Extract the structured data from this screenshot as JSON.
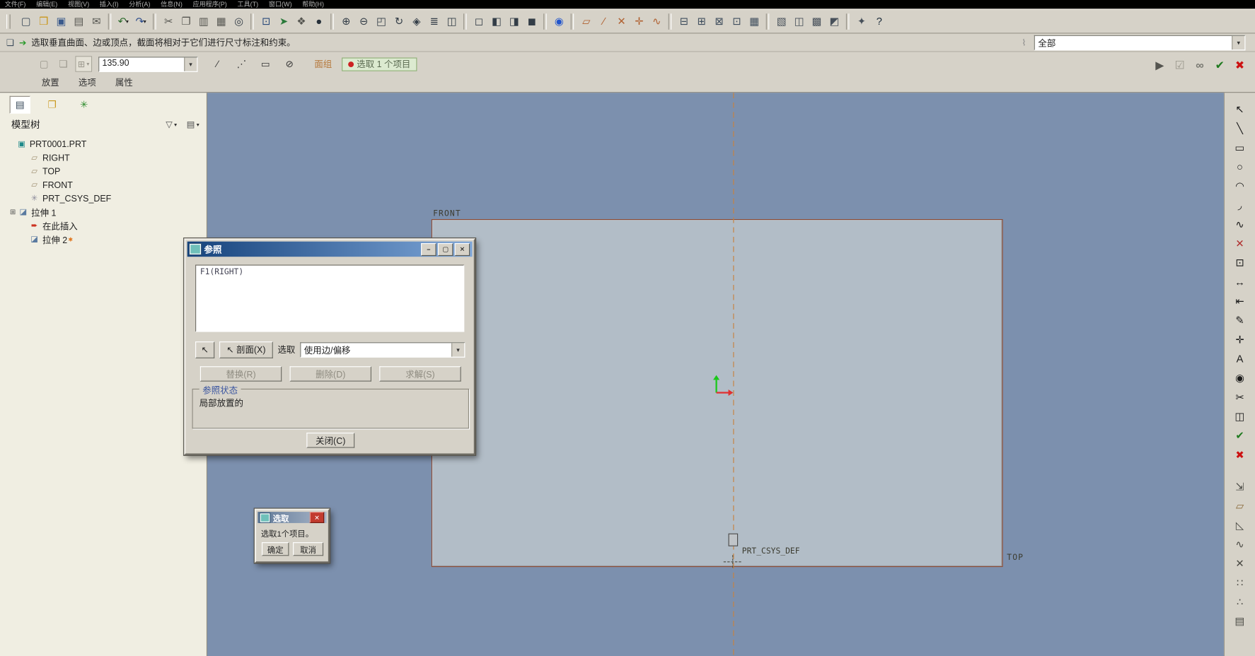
{
  "ui": {
    "caret": "▾"
  },
  "colors": {
    "toolbar_face": "#d6d2c8",
    "canvas_bg": "#7c90ae",
    "plane_fill": "#b2bdc7",
    "highlight_edge": "#8a4a34",
    "centerline": "#c8813c",
    "titlebar_active": "#16437c",
    "chip_green": "#dcead0",
    "accent_green": "#1f7a1f",
    "accent_red": "#cc1111"
  },
  "menubar": {
    "items": [
      "文件(F)",
      "编辑(E)",
      "视图(V)",
      "插入(I)",
      "分析(A)",
      "信息(N)",
      "应用程序(P)",
      "工具(T)",
      "窗口(W)",
      "帮助(H)"
    ]
  },
  "toolbar": {
    "icons": [
      {
        "name": "new-file-icon",
        "glyph": "▢",
        "color": "#3d4c5c"
      },
      {
        "name": "open-folder-icon",
        "glyph": "❒",
        "color": "#c9971c"
      },
      {
        "name": "save-icon",
        "glyph": "▣",
        "color": "#3a5a8c"
      },
      {
        "name": "print-icon",
        "glyph": "▤",
        "color": "#555550"
      },
      {
        "name": "mail-icon",
        "glyph": "✉",
        "color": "#555550"
      },
      {
        "sep": true
      },
      {
        "name": "undo-icon",
        "glyph": "↶",
        "color": "#2a6a2a",
        "caret": "▾"
      },
      {
        "name": "redo-icon",
        "glyph": "↷",
        "color": "#2a4a8a",
        "caret": "▾"
      },
      {
        "sep": true
      },
      {
        "name": "cut-icon",
        "glyph": "✂",
        "color": "#555550"
      },
      {
        "name": "copy-icon",
        "glyph": "❐",
        "color": "#555550"
      },
      {
        "name": "paste-icon",
        "glyph": "▥",
        "color": "#555550"
      },
      {
        "name": "clipboard-icon",
        "glyph": "▦",
        "color": "#555550"
      },
      {
        "name": "find-icon",
        "glyph": "◎",
        "color": "#333d47"
      },
      {
        "sep": true
      },
      {
        "name": "select-box-icon",
        "glyph": "⊡",
        "color": "#2a4a7a"
      },
      {
        "name": "smart-select-icon",
        "glyph": "➤",
        "color": "#2a7a3a"
      },
      {
        "name": "filter-list-icon",
        "glyph": "❖",
        "color": "#555550"
      },
      {
        "name": "shaded-sphere-icon",
        "glyph": "●",
        "color": "#26303a"
      },
      {
        "sep": true
      },
      {
        "name": "zoom-in-icon",
        "glyph": "⊕",
        "color": "#333d47"
      },
      {
        "name": "zoom-out-icon",
        "glyph": "⊖",
        "color": "#333d47"
      },
      {
        "name": "refit-icon",
        "glyph": "◰",
        "color": "#333d47"
      },
      {
        "name": "repaint-icon",
        "glyph": "↻",
        "color": "#333d47"
      },
      {
        "name": "reorient-icon",
        "glyph": "◈",
        "color": "#333d47"
      },
      {
        "name": "layers-icon",
        "glyph": "≣",
        "color": "#333d47"
      },
      {
        "name": "view-manager-icon",
        "glyph": "◫",
        "color": "#333d47"
      },
      {
        "sep": true
      },
      {
        "name": "wireframe-icon",
        "glyph": "◻",
        "color": "#333d47"
      },
      {
        "name": "hidden-line-icon",
        "glyph": "◧",
        "color": "#333d47"
      },
      {
        "name": "no-hidden-icon",
        "glyph": "◨",
        "color": "#333d47"
      },
      {
        "name": "shading-icon",
        "glyph": "◼",
        "color": "#333d47"
      },
      {
        "sep": true
      },
      {
        "name": "spin-center-icon",
        "glyph": "◉",
        "color": "#2255cc"
      },
      {
        "sep": true
      },
      {
        "name": "datum-plane-icon",
        "glyph": "▱",
        "color": "#b06030"
      },
      {
        "name": "datum-axis-icon",
        "glyph": "∕",
        "color": "#b06030"
      },
      {
        "name": "datum-point-icon",
        "glyph": "✕",
        "color": "#b06030"
      },
      {
        "name": "datum-csys-icon",
        "glyph": "✛",
        "color": "#b06030"
      },
      {
        "name": "datum-curve-icon",
        "glyph": "∿",
        "color": "#b06030"
      },
      {
        "sep": true
      },
      {
        "name": "plane-display-icon",
        "glyph": "⊟",
        "color": "#3d4c5c"
      },
      {
        "name": "axis-display-icon",
        "glyph": "⊞",
        "color": "#3d4c5c"
      },
      {
        "name": "point-display-icon",
        "glyph": "⊠",
        "color": "#3d4c5c"
      },
      {
        "name": "csys-display-icon",
        "glyph": "⊡",
        "color": "#3d4c5c"
      },
      {
        "name": "grid-display-icon",
        "glyph": "▦",
        "color": "#3d4c5c"
      },
      {
        "sep": true
      },
      {
        "name": "annotation-icon",
        "glyph": "▧",
        "color": "#47505a"
      },
      {
        "name": "notes-icon",
        "glyph": "◫",
        "color": "#47505a"
      },
      {
        "name": "symbols-icon",
        "glyph": "▩",
        "color": "#47505a"
      },
      {
        "name": "references-icon",
        "glyph": "◩",
        "color": "#47505a"
      },
      {
        "sep": true
      },
      {
        "name": "model-setup-icon",
        "glyph": "✦",
        "color": "#47505a"
      },
      {
        "name": "context-help-icon",
        "glyph": "?",
        "color": "#1a2a3a"
      }
    ]
  },
  "message_bar": {
    "icon_glyph": "❏",
    "arrow_glyph": "➔",
    "text": "选取垂直曲面、边或顶点，截面将相对于它们进行尺寸标注和约束。",
    "analysis_glyph": "⌇",
    "filter_value": "全部"
  },
  "dashboard": {
    "left_buttons": [
      {
        "name": "sketch-plane-icon",
        "glyph": "▢",
        "color": "#9a978c"
      },
      {
        "name": "sketch-view-icon",
        "glyph": "❏",
        "color": "#9a978c"
      }
    ],
    "grid_glyph": "⊞",
    "depth_value": "135.90",
    "mid_icons": [
      {
        "name": "flip-direction-icon",
        "glyph": "∕",
        "color": "#333"
      },
      {
        "name": "thicken-icon",
        "glyph": "⋰",
        "color": "#333"
      },
      {
        "name": "symmetric-icon",
        "glyph": "▭",
        "color": "#333"
      },
      {
        "name": "remove-material-icon",
        "glyph": "⊘",
        "color": "#333"
      }
    ],
    "surface_label": "面组",
    "status_chip": "选取 1 个项目",
    "tabs": [
      "放置",
      "选项",
      "属性"
    ],
    "right_controls": [
      {
        "name": "play-forward-icon",
        "glyph": "▶",
        "color": "#555550"
      },
      {
        "name": "pause-check-icon",
        "glyph": "☑",
        "color": "#9a978c"
      },
      {
        "name": "verify-preview-icon",
        "glyph": "∞",
        "color": "#777770"
      },
      {
        "name": "accept-feature-icon",
        "glyph": "✔",
        "color": "#1f7a1f"
      },
      {
        "name": "cancel-feature-icon",
        "glyph": "✖",
        "color": "#cc1111"
      }
    ]
  },
  "model_tree": {
    "tabs": [
      {
        "name": "model-tree-tab",
        "glyph": "▤",
        "color": "#334455",
        "selected": true
      },
      {
        "name": "folder-browser-tab",
        "glyph": "❒",
        "color": "#c9971c"
      },
      {
        "name": "favorites-tab",
        "glyph": "✳",
        "color": "#2a8a2a"
      }
    ],
    "title": "模型树",
    "filter_button_glyph": "▽",
    "columns_button_glyph": "▤",
    "items": [
      {
        "name": "tree-item-part",
        "label": "PRT0001.PRT",
        "icon": "▣",
        "icon_color": "#1f8a8a",
        "indent": 8,
        "exp": ""
      },
      {
        "name": "tree-item-right",
        "label": "RIGHT",
        "icon": "▱",
        "icon_color": "#9a8a6a",
        "indent": 24,
        "exp": ""
      },
      {
        "name": "tree-item-top",
        "label": "TOP",
        "icon": "▱",
        "icon_color": "#9a8a6a",
        "indent": 24,
        "exp": ""
      },
      {
        "name": "tree-item-front",
        "label": "FRONT",
        "icon": "▱",
        "icon_color": "#9a8a6a",
        "indent": 24,
        "exp": ""
      },
      {
        "name": "tree-item-csys",
        "label": "PRT_CSYS_DEF",
        "icon": "✳",
        "icon_color": "#8a8a9a",
        "indent": 24,
        "exp": ""
      },
      {
        "name": "tree-item-extrude1",
        "label": "拉伸 1",
        "icon": "◪",
        "icon_color": "#5a7aa0",
        "indent": 10,
        "exp": "⊞"
      },
      {
        "name": "tree-item-insert-here",
        "label": "在此插入",
        "icon": "➨",
        "icon_color": "#cc3322",
        "indent": 24,
        "exp": ""
      },
      {
        "name": "tree-item-extrude2",
        "label": "拉伸 2",
        "icon": "◪",
        "icon_color": "#5a7aa0",
        "indent": 24,
        "exp": "",
        "badge": "✱"
      }
    ]
  },
  "canvas": {
    "front_label": "FRONT",
    "top_label": "TOP",
    "csys_label": "PRT_CSYS_DEF"
  },
  "right_toolbar": {
    "icons": [
      {
        "name": "select-arrow-icon",
        "glyph": "↖",
        "color": "#1a1a1a"
      },
      {
        "name": "line-tool-icon",
        "glyph": "╲",
        "color": "#1a1a1a"
      },
      {
        "name": "rectangle-tool-icon",
        "glyph": "▭",
        "color": "#1a1a1a"
      },
      {
        "name": "circle-tool-icon",
        "glyph": "○",
        "color": "#1a1a1a"
      },
      {
        "name": "arc-tool-icon",
        "glyph": "◠",
        "color": "#1a1a1a"
      },
      {
        "name": "fillet-tool-icon",
        "glyph": "◞",
        "color": "#1a1a1a"
      },
      {
        "name": "spline-tool-icon",
        "glyph": "∿",
        "color": "#1a1a1a"
      },
      {
        "name": "point-tool-icon",
        "glyph": "✕",
        "color": "#b03030"
      },
      {
        "name": "use-edge-icon",
        "glyph": "⊡",
        "color": "#1a1a1a"
      },
      {
        "name": "dimension-tool-icon",
        "glyph": "↔",
        "color": "#1a1a1a"
      },
      {
        "name": "baseline-dim-icon",
        "glyph": "⇤",
        "color": "#1a1a1a"
      },
      {
        "name": "modify-dim-icon",
        "glyph": "✎",
        "color": "#1a1a1a"
      },
      {
        "name": "constraint-tool-icon",
        "glyph": "✛",
        "color": "#1a1a1a"
      },
      {
        "name": "text-tool-icon",
        "glyph": "A",
        "color": "#1a1a1a"
      },
      {
        "name": "palette-icon",
        "glyph": "◉",
        "color": "#1a1a1a"
      },
      {
        "name": "trim-tool-icon",
        "glyph": "✂",
        "color": "#1a1a1a"
      },
      {
        "name": "mirror-tool-icon",
        "glyph": "◫",
        "color": "#1a1a1a"
      },
      {
        "name": "sketch-done-icon",
        "glyph": "✔",
        "color": "#1f7a1f"
      },
      {
        "name": "sketch-quit-icon",
        "glyph": "✖",
        "color": "#cc1111"
      },
      {
        "sep": true
      },
      {
        "name": "offset-edge-icon",
        "glyph": "⇲",
        "color": "#4a4a44"
      },
      {
        "name": "parallelogram-icon",
        "glyph": "▱",
        "color": "#8a6a3a"
      },
      {
        "name": "chamfer-icon",
        "glyph": "◺",
        "color": "#4a4a44"
      },
      {
        "name": "curve-icon",
        "glyph": "∿",
        "color": "#4a4a44"
      },
      {
        "name": "delete-segment-icon",
        "glyph": "✕",
        "color": "#4a4a44"
      },
      {
        "name": "pattern-icon",
        "glyph": "∷",
        "color": "#4a4a44"
      },
      {
        "name": "points-grid-icon",
        "glyph": "∴",
        "color": "#4a4a44"
      },
      {
        "name": "hatch-grid-icon",
        "glyph": "▤",
        "color": "#4a4a44"
      }
    ]
  },
  "ref_dialog": {
    "title": "参照",
    "window_buttons": [
      {
        "name": "minimize-button",
        "glyph": "–"
      },
      {
        "name": "maximize-button",
        "glyph": "▢"
      },
      {
        "name": "close-button",
        "glyph": "✕"
      }
    ],
    "list_items": [
      "F1(RIGHT)"
    ],
    "arrow_button_glyph": "↖",
    "section_button": "剖面(X)",
    "select_label": "选取",
    "select_value": "使用边/偏移",
    "action_buttons": [
      {
        "name": "replace-button",
        "label": "替换(R)"
      },
      {
        "name": "delete-button",
        "label": "删除(D)"
      },
      {
        "name": "solve-button",
        "label": "求解(S)"
      }
    ],
    "group_title": "参照状态",
    "status_text": "局部放置的",
    "close_label": "关闭(C)"
  },
  "select_dialog": {
    "title": "选取",
    "close_glyph": "✕",
    "message": "选取1个项目。",
    "ok_label": "确定",
    "cancel_label": "取消"
  }
}
